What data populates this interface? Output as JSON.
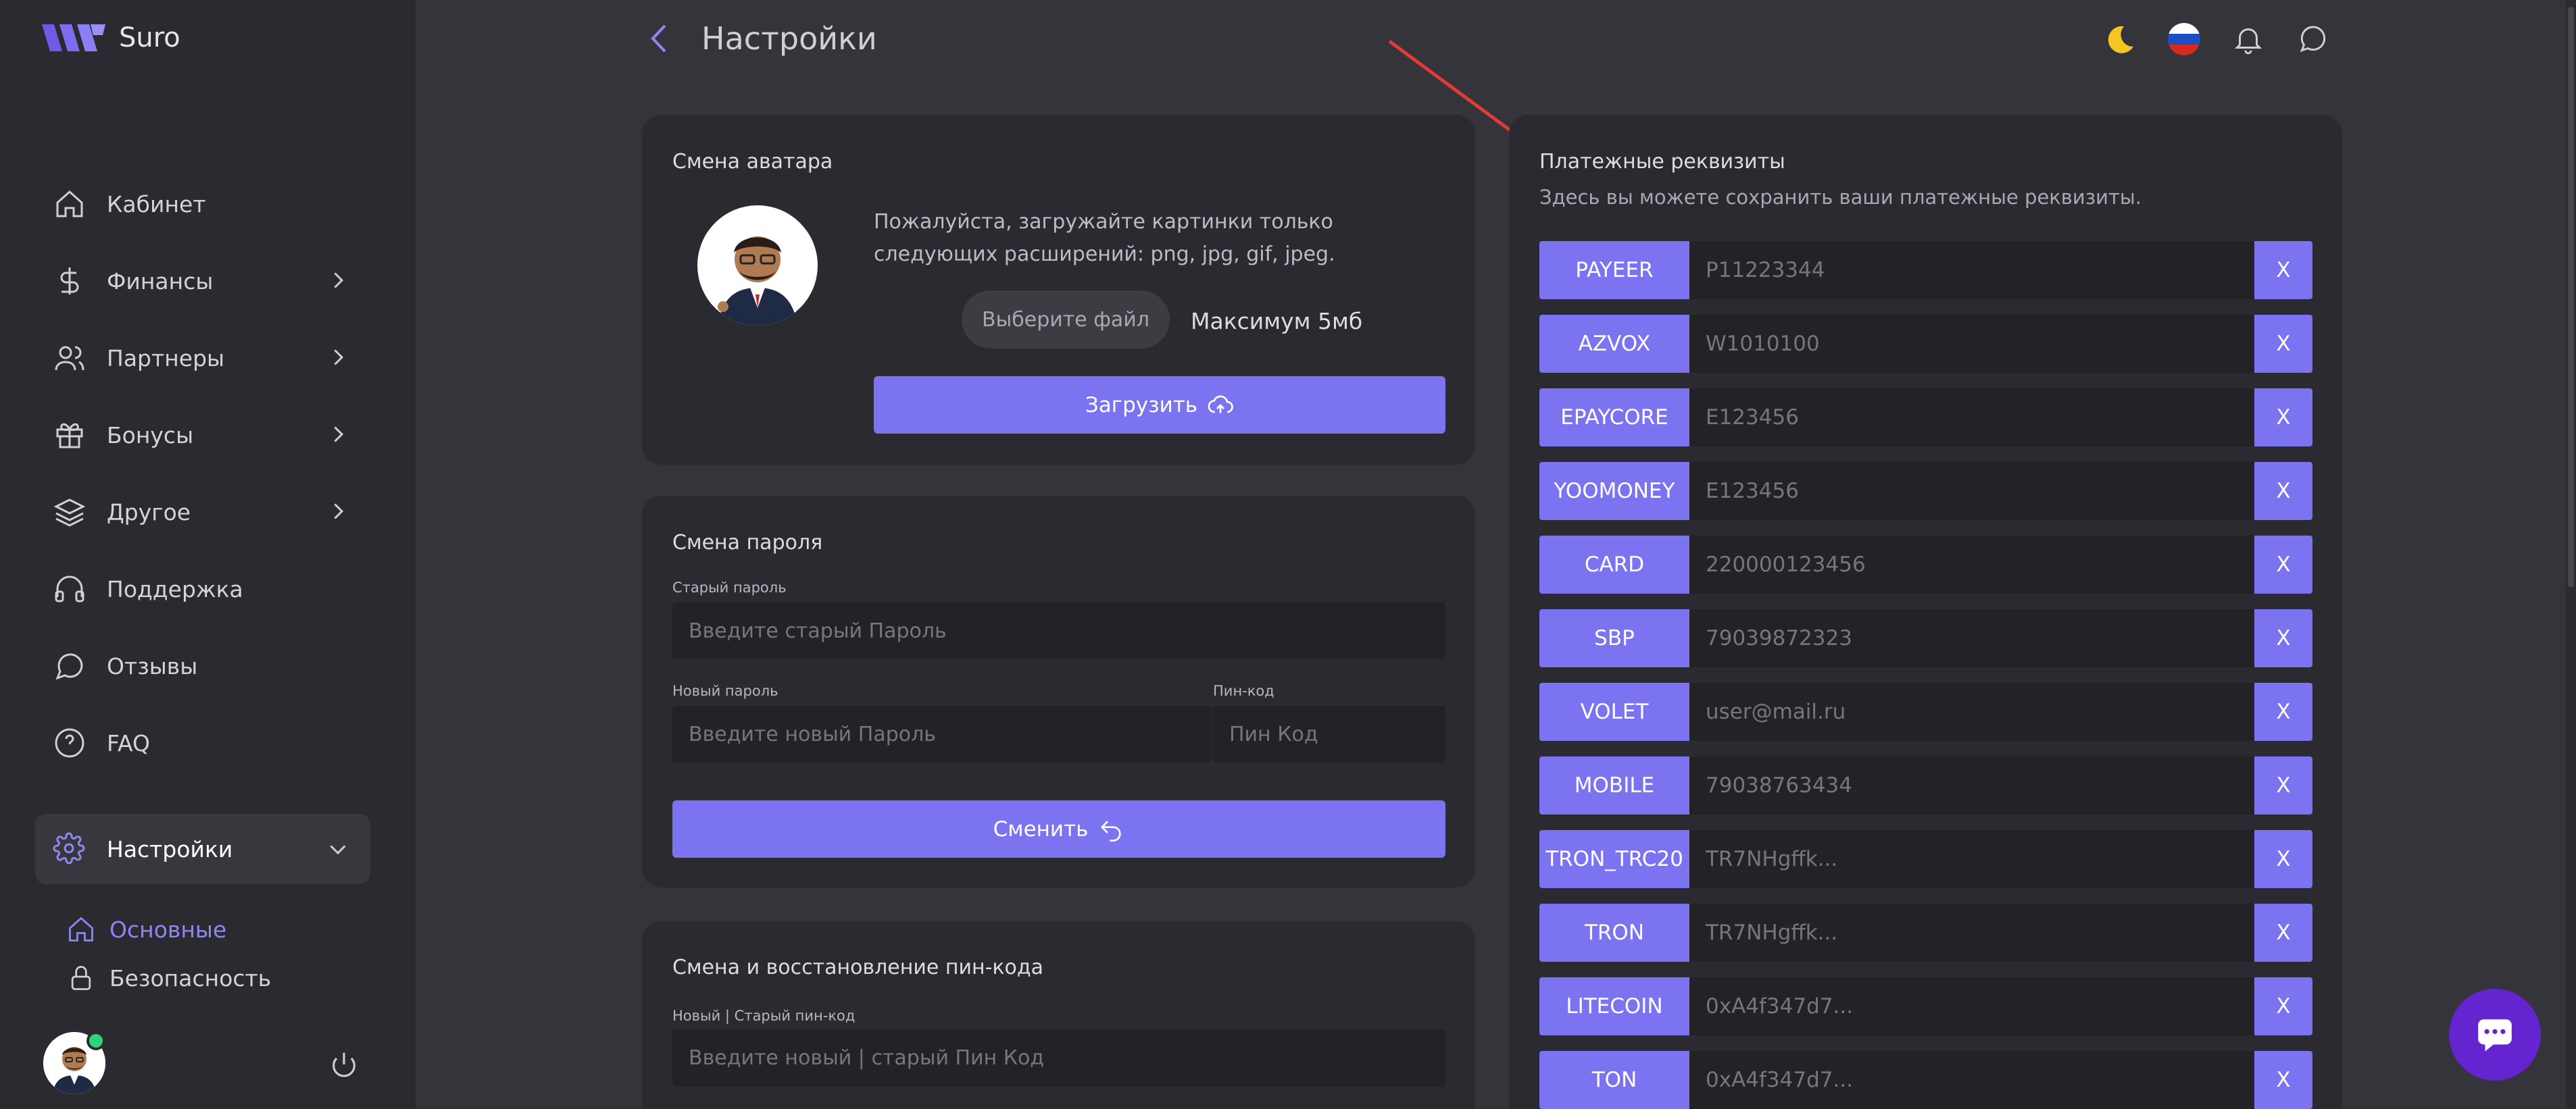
{
  "app": {
    "name": "Suro"
  },
  "sidebar": {
    "items": [
      {
        "label": "Кабинет",
        "icon": "home-icon"
      },
      {
        "label": "Финансы",
        "icon": "dollar-icon"
      },
      {
        "label": "Партнеры",
        "icon": "users-icon"
      },
      {
        "label": "Бонусы",
        "icon": "gift-icon"
      },
      {
        "label": "Другое",
        "icon": "layers-icon"
      },
      {
        "label": "Поддержка",
        "icon": "headphones-icon"
      },
      {
        "label": "Отзывы",
        "icon": "chat-icon"
      },
      {
        "label": "FAQ",
        "icon": "help-icon"
      }
    ],
    "active": {
      "label": "Настройки",
      "icon": "gear-icon"
    },
    "sub_items": [
      {
        "label": "Основные",
        "icon": "home-icon",
        "active": true
      },
      {
        "label": "Безопасность",
        "icon": "lock-icon",
        "active": false
      }
    ]
  },
  "header": {
    "title": "Настройки"
  },
  "avatar_card": {
    "title": "Смена аватара",
    "hint": "Пожалуйста, загружайте картинки только следующих расширений: png, jpg, gif, jpeg.",
    "choose_file": "Выберите файл",
    "max_size": "Максимум 5мб",
    "upload_button": "Загрузить"
  },
  "password_card": {
    "title": "Смена пароля",
    "old_label": "Старый пароль",
    "old_placeholder": "Введите старый Пароль",
    "new_label": "Новый пароль",
    "new_placeholder": "Введите новый Пароль",
    "pin_label": "Пин-код",
    "pin_placeholder": "Пин Код",
    "submit_button": "Сменить"
  },
  "pin_card": {
    "title": "Смена и восстановление пин-кода",
    "label": "Новый | Старый пин-код",
    "placeholder": "Введите новый | старый Пин Код"
  },
  "payments": {
    "title": "Платежные реквизиты",
    "subtitle": "Здесь вы можете сохранить ваши платежные реквизиты.",
    "delete_label": "X",
    "rows": [
      {
        "name": "PAYEER",
        "value": "P11223344"
      },
      {
        "name": "AZVOX",
        "value": "W1010100"
      },
      {
        "name": "EPAYCORE",
        "value": "E123456"
      },
      {
        "name": "YOOMONEY",
        "value": "E123456"
      },
      {
        "name": "CARD",
        "value": "220000123456"
      },
      {
        "name": "SBP",
        "value": "79039872323"
      },
      {
        "name": "VOLET",
        "value": "user@mail.ru"
      },
      {
        "name": "MOBILE",
        "value": "79038763434"
      },
      {
        "name": "TRON_TRC20",
        "value": "TR7NHgffk..."
      },
      {
        "name": "TRON",
        "value": "TR7NHgffk..."
      },
      {
        "name": "LITECOIN",
        "value": "0xA4f347d7..."
      },
      {
        "name": "TON",
        "value": "0xA4f347d7..."
      }
    ]
  },
  "colors": {
    "accent": "#7b73f0",
    "sidebar_bg": "#2b2a30",
    "page_bg": "#35343b",
    "chat_bubble": "#6425d0"
  }
}
